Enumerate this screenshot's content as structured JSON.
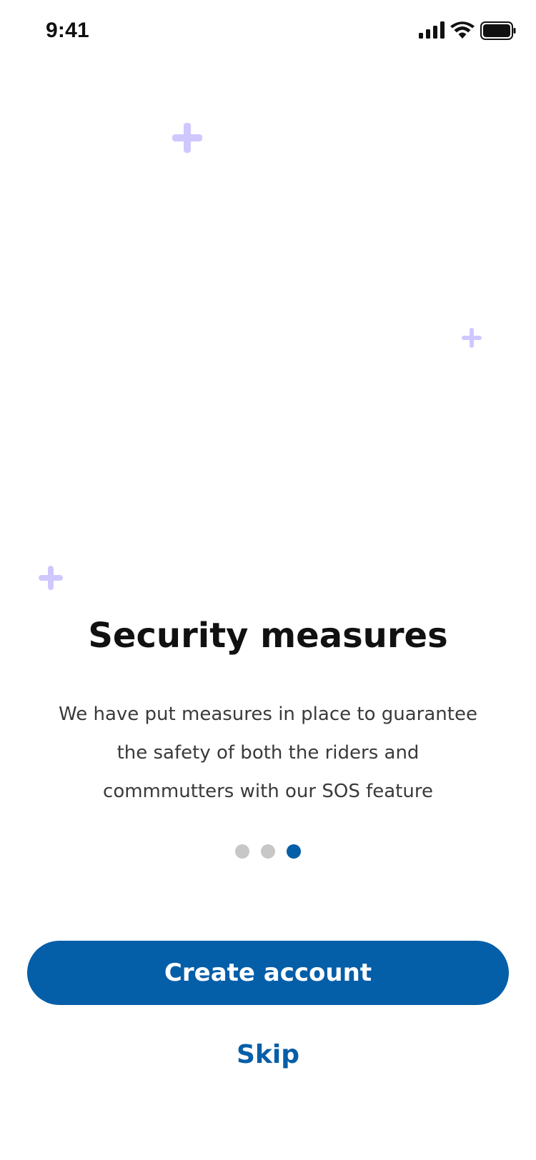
{
  "status_bar": {
    "time": "9:41",
    "icons": [
      "signal-icon",
      "wifi-icon",
      "battery-icon"
    ]
  },
  "onboarding": {
    "title": "Security measures",
    "description": "We have put measures in place to guarantee the safety of both the riders and commmutters with our SOS feature",
    "pagination": {
      "total": 3,
      "active_index": 2
    },
    "cta_label": "Create account",
    "skip_label": "Skip"
  },
  "colors": {
    "primary": "#055ea8",
    "decor_plus": "#cfc8ff",
    "inactive_dot": "#c7c7c7",
    "text_dark": "#111111",
    "text_body": "#3a3a3a"
  }
}
